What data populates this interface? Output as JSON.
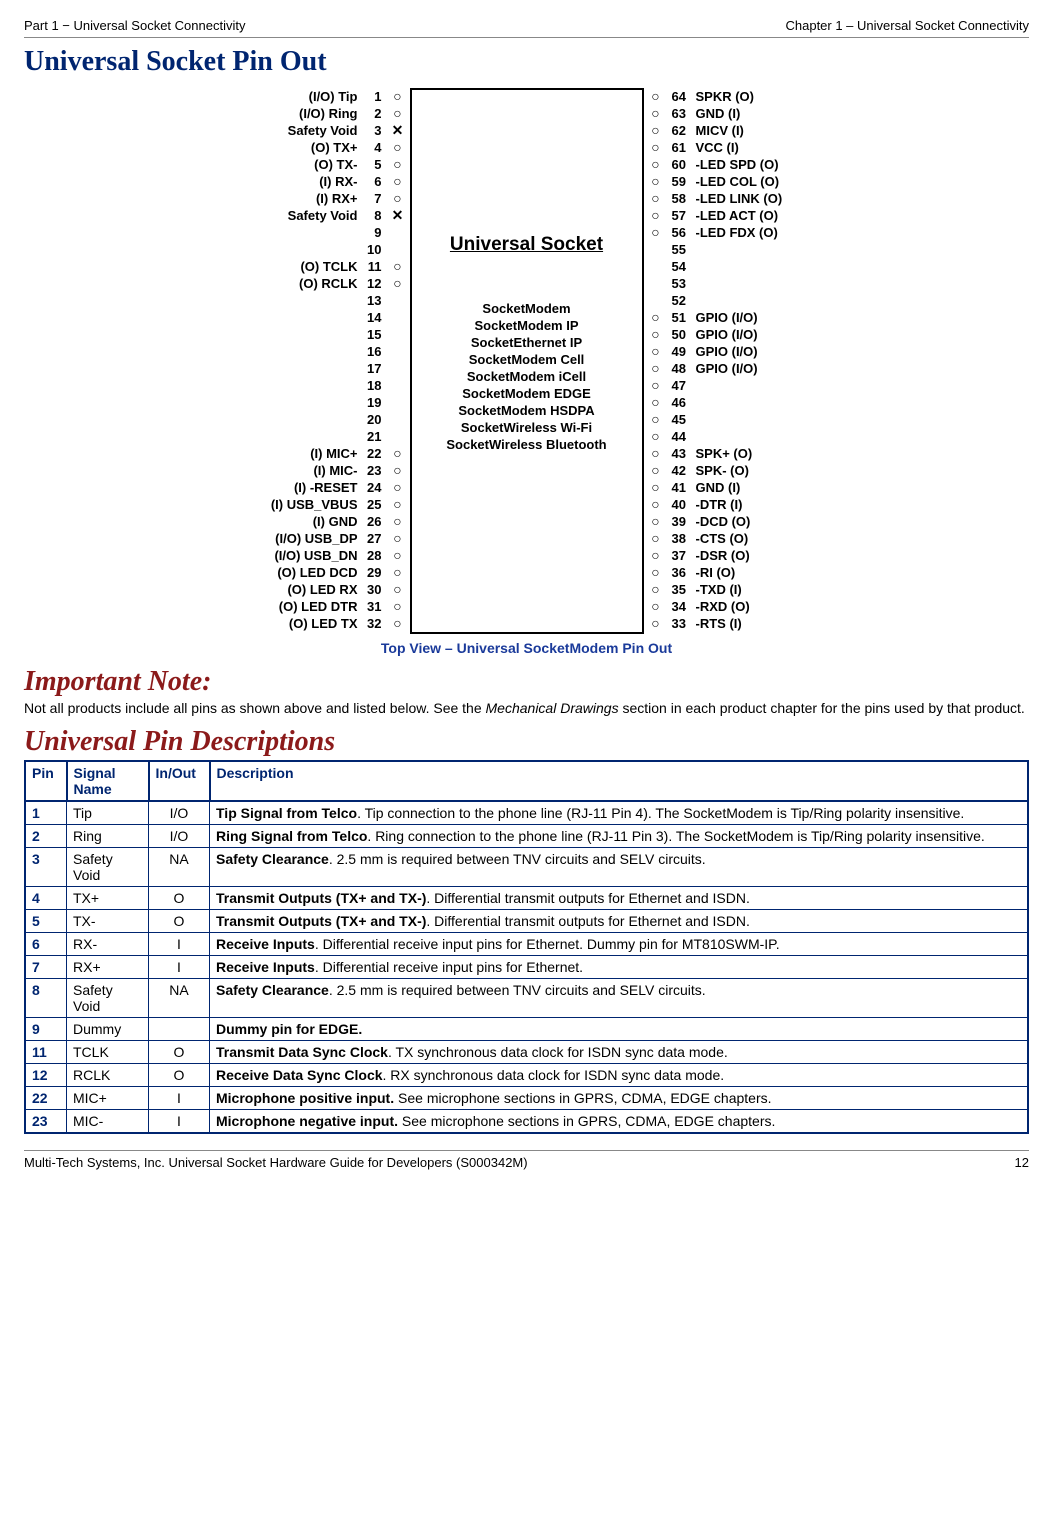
{
  "header": {
    "left": "Part 1 − Universal Socket Connectivity",
    "right": "Chapter 1 – Universal Socket Connectivity"
  },
  "footer": {
    "left": "Multi-Tech Systems, Inc. Universal Socket Hardware Guide for Developers (S000342M)",
    "right": "12"
  },
  "title_main": "Universal Socket Pin Out",
  "caption": "Top View – Universal SocketModem Pin Out",
  "note_heading": "Important Note:",
  "note_text_1": "Not all products include all pins as shown above and listed below. See the ",
  "note_text_mech": "Mechanical Drawings",
  "note_text_2": " section in each product chapter for the pins used by that product.",
  "title_pins": "Universal Pin Descriptions",
  "diagram": {
    "center_title": "Universal Socket",
    "center_list": [
      "SocketModem",
      "SocketModem IP",
      "SocketEthernet IP",
      "SocketModem Cell",
      "SocketModem iCell",
      "SocketModem EDGE",
      "SocketModem HSDPA",
      "SocketWireless Wi-Fi",
      "SocketWireless Bluetooth"
    ],
    "left": [
      {
        "n": 1,
        "l": "(I/O) Tip",
        "m": "o"
      },
      {
        "n": 2,
        "l": "(I/O) Ring",
        "m": "o"
      },
      {
        "n": 3,
        "l": "Safety Void",
        "m": "x"
      },
      {
        "n": 4,
        "l": "(O) TX+",
        "m": "o"
      },
      {
        "n": 5,
        "l": "(O) TX-",
        "m": "o"
      },
      {
        "n": 6,
        "l": "(I) RX-",
        "m": "o"
      },
      {
        "n": 7,
        "l": "(I) RX+",
        "m": "o"
      },
      {
        "n": 8,
        "l": "Safety Void",
        "m": "x"
      },
      {
        "n": 9,
        "l": "",
        "m": ""
      },
      {
        "n": 10,
        "l": "",
        "m": ""
      },
      {
        "n": 11,
        "l": "(O) TCLK",
        "m": "o"
      },
      {
        "n": 12,
        "l": "(O) RCLK",
        "m": "o"
      },
      {
        "n": 13,
        "l": "",
        "m": ""
      },
      {
        "n": 14,
        "l": "",
        "m": ""
      },
      {
        "n": 15,
        "l": "",
        "m": ""
      },
      {
        "n": 16,
        "l": "",
        "m": ""
      },
      {
        "n": 17,
        "l": "",
        "m": ""
      },
      {
        "n": 18,
        "l": "",
        "m": ""
      },
      {
        "n": 19,
        "l": "",
        "m": ""
      },
      {
        "n": 20,
        "l": "",
        "m": ""
      },
      {
        "n": 21,
        "l": "",
        "m": ""
      },
      {
        "n": 22,
        "l": "(I) MIC+",
        "m": "o"
      },
      {
        "n": 23,
        "l": "(I) MIC-",
        "m": "o"
      },
      {
        "n": 24,
        "l": "(I) -RESET",
        "m": "o"
      },
      {
        "n": 25,
        "l": "(I) USB_VBUS",
        "m": "o"
      },
      {
        "n": 26,
        "l": "(I) GND",
        "m": "o"
      },
      {
        "n": 27,
        "l": "(I/O) USB_DP",
        "m": "o"
      },
      {
        "n": 28,
        "l": "(I/O) USB_DN",
        "m": "o"
      },
      {
        "n": 29,
        "l": "(O) LED DCD",
        "m": "o"
      },
      {
        "n": 30,
        "l": "(O) LED RX",
        "m": "o"
      },
      {
        "n": 31,
        "l": "(O) LED DTR",
        "m": "o"
      },
      {
        "n": 32,
        "l": "(O) LED TX",
        "m": "o"
      }
    ],
    "right": [
      {
        "n": 64,
        "l": "SPKR (O)",
        "m": "o"
      },
      {
        "n": 63,
        "l": "GND (I)",
        "m": "o"
      },
      {
        "n": 62,
        "l": "MICV (I)",
        "m": "o"
      },
      {
        "n": 61,
        "l": "VCC (I)",
        "m": "o"
      },
      {
        "n": 60,
        "l": "-LED SPD (O)",
        "m": "o"
      },
      {
        "n": 59,
        "l": "-LED COL (O)",
        "m": "o"
      },
      {
        "n": 58,
        "l": "-LED LINK (O)",
        "m": "o"
      },
      {
        "n": 57,
        "l": "-LED ACT (O)",
        "m": "o"
      },
      {
        "n": 56,
        "l": "-LED FDX (O)",
        "m": "o"
      },
      {
        "n": 55,
        "l": "",
        "m": ""
      },
      {
        "n": 54,
        "l": "",
        "m": ""
      },
      {
        "n": 53,
        "l": "",
        "m": ""
      },
      {
        "n": 52,
        "l": "",
        "m": ""
      },
      {
        "n": 51,
        "l": "GPIO (I/O)",
        "m": "o"
      },
      {
        "n": 50,
        "l": "GPIO (I/O)",
        "m": "o"
      },
      {
        "n": 49,
        "l": "GPIO (I/O)",
        "m": "o"
      },
      {
        "n": 48,
        "l": "GPIO (I/O)",
        "m": "o"
      },
      {
        "n": 47,
        "l": "",
        "m": "o"
      },
      {
        "n": 46,
        "l": "",
        "m": "o"
      },
      {
        "n": 45,
        "l": "",
        "m": "o"
      },
      {
        "n": 44,
        "l": "",
        "m": "o"
      },
      {
        "n": 43,
        "l": "SPK+ (O)",
        "m": "o"
      },
      {
        "n": 42,
        "l": "SPK- (O)",
        "m": "o"
      },
      {
        "n": 41,
        "l": "GND (I)",
        "m": "o"
      },
      {
        "n": 40,
        "l": "-DTR (I)",
        "m": "o"
      },
      {
        "n": 39,
        "l": "-DCD (O)",
        "m": "o"
      },
      {
        "n": 38,
        "l": "-CTS (O)",
        "m": "o"
      },
      {
        "n": 37,
        "l": "-DSR (O)",
        "m": "o"
      },
      {
        "n": 36,
        "l": "-RI (O)",
        "m": "o"
      },
      {
        "n": 35,
        "l": "-TXD (I)",
        "m": "o"
      },
      {
        "n": 34,
        "l": "-RXD (O)",
        "m": "o"
      },
      {
        "n": 33,
        "l": "-RTS (I)",
        "m": "o"
      }
    ]
  },
  "table": {
    "headers": {
      "pin": "Pin",
      "sig": "Signal Name",
      "io": "In/Out",
      "desc": "Description"
    },
    "rows": [
      {
        "pin": "1",
        "sig": "Tip",
        "io": "I/O",
        "b": "Tip Signal from Telco",
        "rest": ". Tip connection to the phone line (RJ-11 Pin 4). The SocketModem is Tip/Ring polarity insensitive."
      },
      {
        "pin": "2",
        "sig": "Ring",
        "io": "I/O",
        "b": "Ring Signal from Telco",
        "rest": ". Ring connection to the phone line (RJ-11 Pin 3). The SocketModem is Tip/Ring polarity insensitive."
      },
      {
        "pin": "3",
        "sig": "Safety Void",
        "io": "NA",
        "b": "Safety Clearance",
        "rest": ". 2.5 mm is required between TNV circuits and SELV circuits."
      },
      {
        "pin": "4",
        "sig": "TX+",
        "io": "O",
        "b": "Transmit Outputs (TX+ and TX-)",
        "rest": ". Differential transmit outputs for Ethernet and ISDN."
      },
      {
        "pin": "5",
        "sig": "TX-",
        "io": "O",
        "b": "Transmit Outputs (TX+ and TX-)",
        "rest": ". Differential transmit outputs for Ethernet and ISDN."
      },
      {
        "pin": "6",
        "sig": "RX-",
        "io": "I",
        "b": "Receive Inputs",
        "rest": ". Differential receive input pins for Ethernet. Dummy pin for MT810SWM-IP."
      },
      {
        "pin": "7",
        "sig": "RX+",
        "io": "I",
        "b": "Receive Inputs",
        "rest": ". Differential receive input pins for Ethernet."
      },
      {
        "pin": "8",
        "sig": "Safety Void",
        "io": "NA",
        "b": "Safety Clearance",
        "rest": ". 2.5 mm is required between TNV circuits and SELV circuits."
      },
      {
        "pin": "9",
        "sig": "Dummy",
        "io": "",
        "b": "Dummy pin for EDGE.",
        "rest": ""
      },
      {
        "pin": "11",
        "sig": "TCLK",
        "io": "O",
        "b": "Transmit Data Sync Clock",
        "rest": ". TX synchronous data clock for ISDN sync data mode."
      },
      {
        "pin": "12",
        "sig": "RCLK",
        "io": "O",
        "b": "Receive Data Sync Clock",
        "rest": ". RX synchronous data clock for ISDN sync data mode."
      },
      {
        "pin": "22",
        "sig": "MIC+",
        "io": "I",
        "b": "Microphone positive input.",
        "rest": " See microphone sections in GPRS, CDMA, EDGE chapters."
      },
      {
        "pin": "23",
        "sig": "MIC-",
        "io": "I",
        "b": "Microphone negative input.",
        "rest": " See microphone sections in GPRS, CDMA, EDGE chapters."
      }
    ]
  }
}
